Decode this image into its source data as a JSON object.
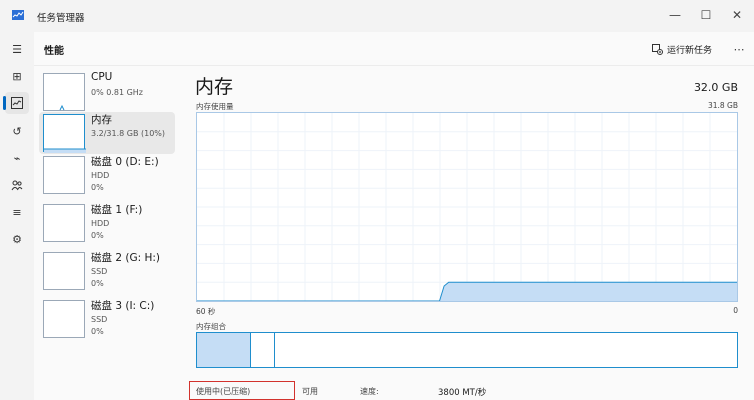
{
  "window": {
    "title": "任务管理器",
    "minimize": "—",
    "maximize": "☐",
    "close": "✕"
  },
  "nav": {
    "items": [
      {
        "icon": "hamburger-menu-icon",
        "glyph": "☰"
      },
      {
        "icon": "processes-icon",
        "glyph": "⊞"
      },
      {
        "icon": "performance-icon",
        "glyph": "📈"
      },
      {
        "icon": "app-history-icon",
        "glyph": "↺"
      },
      {
        "icon": "startup-apps-icon",
        "glyph": "⌁"
      },
      {
        "icon": "users-icon",
        "glyph": "👥"
      },
      {
        "icon": "details-icon",
        "glyph": "≡"
      },
      {
        "icon": "services-icon",
        "glyph": "⚙"
      }
    ]
  },
  "header": {
    "title": "性能",
    "run_task": "运行新任务",
    "more": "⋯"
  },
  "resources": [
    {
      "name": "CPU",
      "lines": [
        "0% 0.81 GHz"
      ]
    },
    {
      "name": "内存",
      "lines": [
        "3.2/31.8 GB (10%)"
      ]
    },
    {
      "name": "磁盘 0 (D: E:)",
      "lines": [
        "HDD",
        "0%"
      ]
    },
    {
      "name": "磁盘 1 (F:)",
      "lines": [
        "HDD",
        "0%"
      ]
    },
    {
      "name": "磁盘 2 (G: H:)",
      "lines": [
        "SSD",
        "0%"
      ]
    },
    {
      "name": "磁盘 3 (I: C:)",
      "lines": [
        "SSD",
        "0%"
      ]
    }
  ],
  "memory": {
    "title": "内存",
    "total": "32.0 GB",
    "usage_label": "内存使用量",
    "usage_max": "31.8 GB",
    "time_left": "60 秒",
    "time_right": "0",
    "composition_label": "内存组合",
    "usage_fraction": 0.1,
    "history": [
      0,
      0,
      0,
      0,
      0,
      0,
      0,
      0,
      0,
      0,
      0,
      0,
      0,
      0,
      0,
      0,
      0,
      0,
      0,
      0,
      0,
      0,
      0,
      0,
      0,
      0,
      0,
      0,
      0,
      0,
      0,
      0,
      0,
      0,
      0,
      0,
      0,
      0,
      0,
      0,
      0,
      0,
      0,
      0,
      0,
      0,
      0,
      0,
      0,
      0,
      0,
      0,
      0,
      0,
      0.08,
      0.1,
      0.1,
      0.1,
      0.1,
      0.1,
      0.1,
      0.1,
      0.1,
      0.1,
      0.1,
      0.1,
      0.1,
      0.1,
      0.1,
      0.1,
      0.1,
      0.1,
      0.1,
      0.1,
      0.1,
      0.1,
      0.1,
      0.1,
      0.1,
      0.1,
      0.1,
      0.1,
      0.1,
      0.1,
      0.1,
      0.1,
      0.1,
      0.1,
      0.1,
      0.1,
      0.1,
      0.1,
      0.1,
      0.1,
      0.1,
      0.1,
      0.1,
      0.1,
      0.1,
      0.1,
      0.1,
      0.1,
      0.1,
      0.1,
      0.1,
      0.1,
      0.1,
      0.1,
      0.1,
      0.1,
      0.1,
      0.1,
      0.1,
      0.1,
      0.1,
      0.1,
      0.1,
      0.1,
      0.1
    ]
  },
  "stats": {
    "in_use_label": "使用中(已压缩)",
    "available_label": "可用",
    "speed_label": "速度:",
    "speed_value": "3800 MT/秒"
  },
  "colors": {
    "accent": "#0067c0",
    "memory_line": "#1f8ecd",
    "memory_fill": "#c5ddf5",
    "highlight_box": "#d2322d"
  }
}
